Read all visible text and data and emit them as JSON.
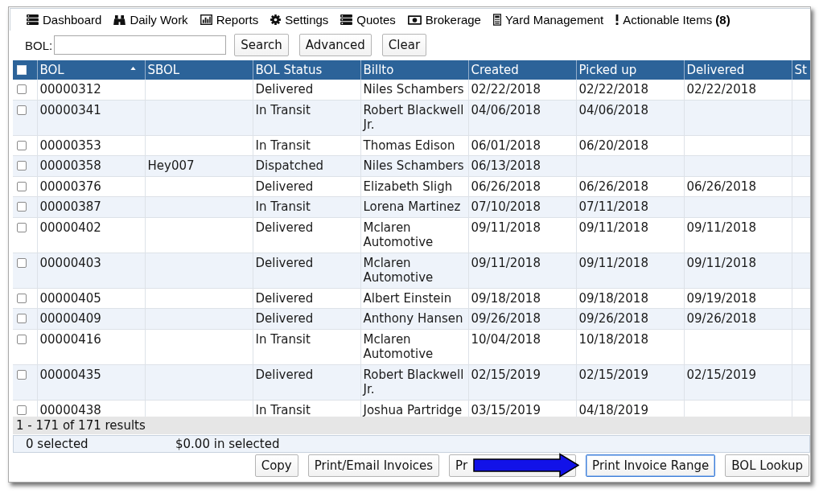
{
  "nav": {
    "items": [
      {
        "label": "Dashboard"
      },
      {
        "label": "Daily Work"
      },
      {
        "label": "Reports"
      },
      {
        "label": "Settings"
      },
      {
        "label": "Quotes"
      },
      {
        "label": "Brokerage"
      },
      {
        "label": "Yard Management"
      },
      {
        "label": "Actionable Items **(8)**"
      }
    ]
  },
  "search": {
    "label": "BOL:",
    "buttons": [
      "Search",
      "Advanced",
      "Clear"
    ]
  },
  "table": {
    "select_all": {
      "checked": false
    },
    "columns": [
      {
        "label": "BOL",
        "sorted": true
      },
      {
        "label": "SBOL",
        "sorted": false
      },
      {
        "label": "BOL Status",
        "sorted": false
      },
      {
        "label": "Billto",
        "sorted": false
      },
      {
        "label": "Created",
        "sorted": false
      },
      {
        "label": "Picked up",
        "sorted": false
      },
      {
        "label": "Delivered",
        "sorted": false
      },
      {
        "label": "St",
        "sorted": false
      }
    ],
    "rows": [
      {
        "bol": "00000312",
        "bol_status": "Delivered",
        "billto": "Niles Schambers",
        "created": "02/22/2018",
        "picked_up": "02/22/2018",
        "delivered": "02/22/2018",
        "selected": false
      },
      {
        "bol": "00000341",
        "bol_status": "In Transit",
        "billto": "Robert Blackwell Jr.",
        "created": "04/06/2018",
        "picked_up": "04/06/2018",
        "selected": false
      },
      {
        "bol": "00000353",
        "bol_status": "In Transit",
        "billto": "Thomas Edison",
        "created": "06/01/2018",
        "picked_up": "06/20/2018",
        "selected": false
      },
      {
        "bol": "00000358",
        "sbol": "Hey007",
        "bol_status": "Dispatched",
        "billto": "Niles Schambers",
        "created": "06/13/2018",
        "selected": false
      },
      {
        "bol": "00000376",
        "bol_status": "Delivered",
        "billto": "Elizabeth Sligh",
        "created": "06/26/2018",
        "picked_up": "06/26/2018",
        "delivered": "06/26/2018",
        "selected": false
      },
      {
        "bol": "00000387",
        "bol_status": "In Transit",
        "billto": "Lorena Martinez",
        "created": "07/10/2018",
        "picked_up": "07/11/2018",
        "selected": false
      },
      {
        "bol": "00000402",
        "bol_status": "Delivered",
        "billto": "Mclaren Automotive",
        "created": "09/11/2018",
        "picked_up": "09/11/2018",
        "delivered": "09/11/2018",
        "selected": false
      },
      {
        "bol": "00000403",
        "bol_status": "Delivered",
        "billto": "Mclaren Automotive",
        "created": "09/11/2018",
        "picked_up": "09/11/2018",
        "delivered": "09/11/2018",
        "selected": false
      },
      {
        "bol": "00000405",
        "bol_status": "Delivered",
        "billto": "Albert Einstein",
        "created": "09/18/2018",
        "picked_up": "09/18/2018",
        "delivered": "09/19/2018",
        "selected": false
      },
      {
        "bol": "00000409",
        "bol_status": "Delivered",
        "billto": "Anthony Hansen",
        "created": "09/26/2018",
        "picked_up": "09/26/2018",
        "delivered": "09/26/2018",
        "selected": false
      },
      {
        "bol": "00000416",
        "bol_status": "In Transit",
        "billto": "Mclaren Automotive",
        "created": "10/04/2018",
        "picked_up": "10/18/2018",
        "selected": false
      },
      {
        "bol": "00000435",
        "bol_status": "Delivered",
        "billto": "Robert Blackwell Jr.",
        "created": "02/15/2019",
        "picked_up": "02/15/2019",
        "delivered": "02/15/2019",
        "selected": false
      },
      {
        "bol": "00000438",
        "bol_status": "In Transit",
        "billto": "Joshua Partridge",
        "created": "03/15/2019",
        "picked_up": "04/18/2019",
        "selected": false
      }
    ]
  },
  "pager": {
    "summary": "1 - 171 of 171 results"
  },
  "selection": {
    "count": "0 selected",
    "amount": "$0.00 in selected"
  },
  "actions": [
    {
      "label": "Copy",
      "focused": false,
      "pointed_at": false
    },
    {
      "label": "Print/Email Invoices",
      "focused": false,
      "pointed_at": false
    },
    {
      "label": "Pr",
      "focused": false,
      "pointed_at": false
    },
    {
      "label": "Print Invoice Range",
      "focused": true,
      "pointed_at": true
    },
    {
      "label": "BOL Lookup",
      "focused": false,
      "pointed_at": false
    }
  ]
}
